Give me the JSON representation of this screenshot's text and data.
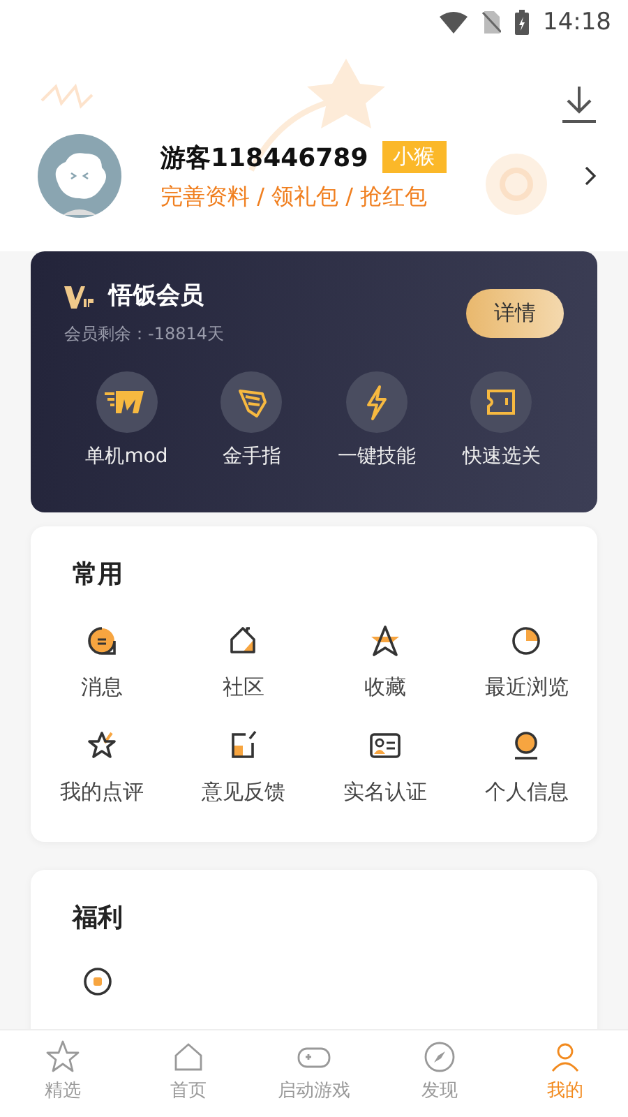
{
  "status_bar": {
    "time": "14:18"
  },
  "profile": {
    "name": "游客118446789",
    "badge": "小猴",
    "links": "完善资料 / 领礼包 / 抢红包"
  },
  "vip": {
    "title": "悟饭会员",
    "remaining": "会员剩余：-18814天",
    "button": "详情",
    "features": [
      "单机mod",
      "金手指",
      "一键技能",
      "快速选关"
    ]
  },
  "common": {
    "title": "常用",
    "items": [
      "消息",
      "社区",
      "收藏",
      "最近浏览",
      "我的点评",
      "意见反馈",
      "实名认证",
      "个人信息"
    ]
  },
  "welfare": {
    "title": "福利"
  },
  "bottom_nav": [
    {
      "label": "精选",
      "selected": false
    },
    {
      "label": "首页",
      "selected": false
    },
    {
      "label": "启动游戏",
      "selected": false
    },
    {
      "label": "发现",
      "selected": false
    },
    {
      "label": "我的",
      "selected": true
    }
  ]
}
